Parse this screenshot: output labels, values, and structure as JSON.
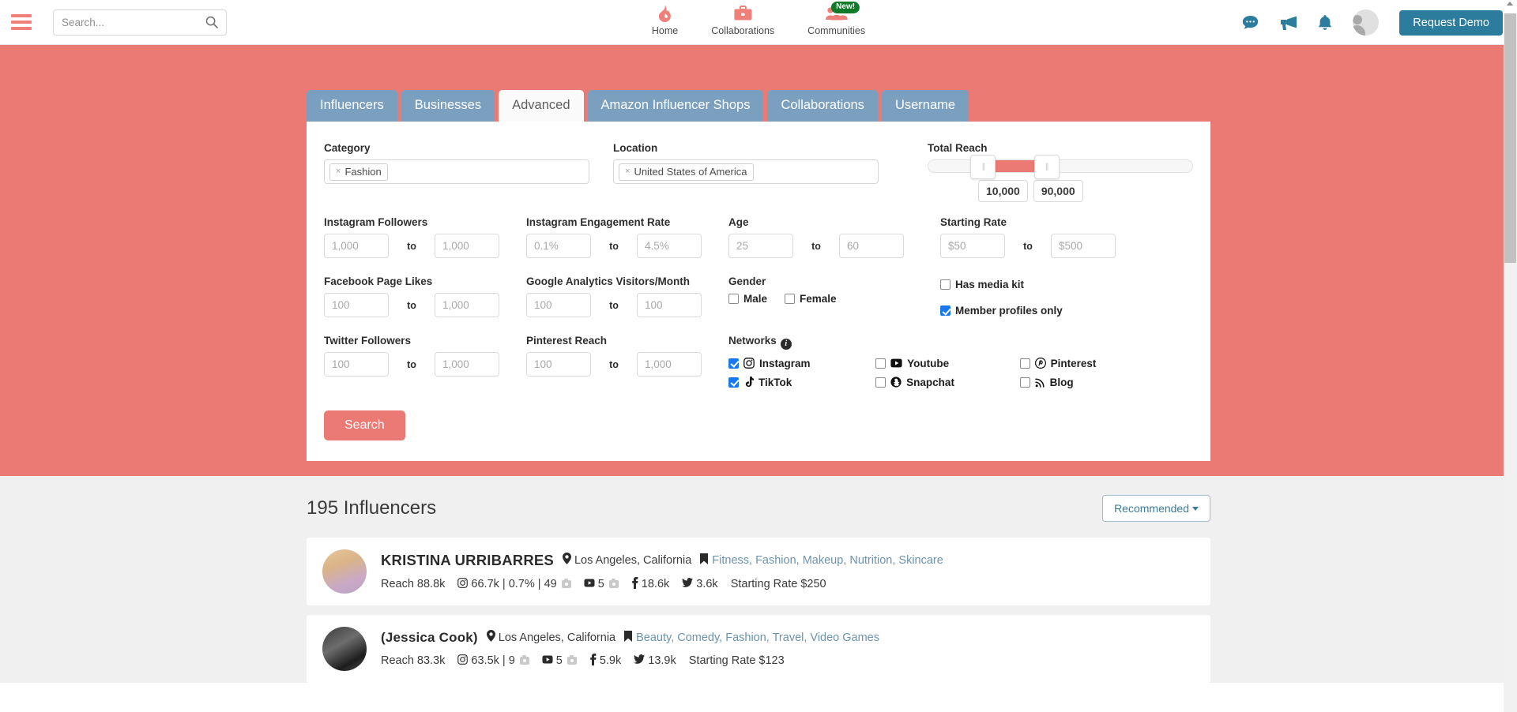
{
  "header": {
    "menu_icon": "hamburger-icon",
    "search_placeholder": "Search...",
    "search_value": "",
    "nav": [
      {
        "label": "Home",
        "icon": "flame-icon",
        "badge": ""
      },
      {
        "label": "Collaborations",
        "icon": "briefcase-icon",
        "badge": ""
      },
      {
        "label": "Communities",
        "icon": "people-icon",
        "badge": "New!"
      }
    ],
    "icons": [
      "chat-icon",
      "megaphone-icon",
      "bell-icon"
    ],
    "avatar": "user-avatar",
    "request_demo": "Request Demo"
  },
  "tabs": [
    {
      "label": "Influencers",
      "active": false
    },
    {
      "label": "Businesses",
      "active": false
    },
    {
      "label": "Advanced",
      "active": true
    },
    {
      "label": "Amazon Influencer Shops",
      "active": false
    },
    {
      "label": "Collaborations",
      "active": false
    },
    {
      "label": "Username",
      "active": false
    }
  ],
  "form": {
    "category": {
      "label": "Category",
      "tokens": [
        "Fashion"
      ]
    },
    "location": {
      "label": "Location",
      "tokens": [
        "United States of America"
      ]
    },
    "total_reach": {
      "label": "Total Reach",
      "min_value": "10,000",
      "max_value": "90,000"
    },
    "ranges": [
      {
        "label": "Instagram Followers",
        "from_placeholder": "1,000",
        "to_placeholder": "1,000",
        "to_label": "to"
      },
      {
        "label": "Instagram Engagement Rate",
        "from_placeholder": "0.1%",
        "to_placeholder": "4.5%",
        "to_label": "to"
      },
      {
        "label": "Age",
        "from_placeholder": "25",
        "to_placeholder": "60",
        "to_label": "to"
      },
      {
        "label": "Starting Rate",
        "from_placeholder": "$50",
        "to_placeholder": "$500",
        "to_label": "to"
      },
      {
        "label": "Facebook Page Likes",
        "from_placeholder": "100",
        "to_placeholder": "1,000",
        "to_label": "to"
      },
      {
        "label": "Google Analytics Visitors/Month",
        "from_placeholder": "100",
        "to_placeholder": "100",
        "to_label": "to"
      },
      {
        "label": "Twitter Followers",
        "from_placeholder": "100",
        "to_placeholder": "1,000",
        "to_label": "to"
      },
      {
        "label": "Pinterest Reach",
        "from_placeholder": "100",
        "to_placeholder": "1,000",
        "to_label": "to"
      }
    ],
    "gender": {
      "label": "Gender",
      "options": [
        {
          "label": "Male",
          "checked": false
        },
        {
          "label": "Female",
          "checked": false
        }
      ]
    },
    "flags": [
      {
        "label": "Has media kit",
        "checked": false
      },
      {
        "label": "Member profiles only",
        "checked": true
      }
    ],
    "networks": {
      "label": "Networks",
      "info_icon": "info-icon",
      "items": [
        {
          "label": "Instagram",
          "icon": "instagram-icon",
          "checked": true
        },
        {
          "label": "Youtube",
          "icon": "youtube-icon",
          "checked": false
        },
        {
          "label": "Pinterest",
          "icon": "pinterest-icon",
          "checked": false
        },
        {
          "label": "TikTok",
          "icon": "tiktok-icon",
          "checked": true
        },
        {
          "label": "Snapchat",
          "icon": "snapchat-icon",
          "checked": false
        },
        {
          "label": "Blog",
          "icon": "rss-icon",
          "checked": false
        }
      ]
    },
    "search_button": "Search"
  },
  "results": {
    "count_title": "195 Influencers",
    "sort_label": "Recommended",
    "cards": [
      {
        "name": "KRISTINA URRIBARRES",
        "location": "Los Angeles, California",
        "categories": "Fitness, Fashion, Makeup, Nutrition, Skincare",
        "reach_label": "Reach",
        "reach": "88.8k",
        "instagram": "66.7k | 0.7% | 49",
        "youtube": "5",
        "facebook": "18.6k",
        "twitter": "3.6k",
        "rate_label": "Starting Rate",
        "rate": "$250"
      },
      {
        "name": "(Jessica Cook)",
        "location": "Los Angeles, California",
        "categories": "Beauty, Comedy, Fashion, Travel, Video Games",
        "reach_label": "Reach",
        "reach": "83.3k",
        "instagram": "63.5k | 9",
        "youtube": "5",
        "facebook": "5.9k",
        "twitter": "13.9k",
        "rate_label": "Starting Rate",
        "rate": "$123"
      }
    ]
  },
  "colors": {
    "salmon": "#ec7a74",
    "tab_blue": "#7ba0bf",
    "teal": "#2c7c9e",
    "checkbox_blue": "#1878f0",
    "badge_green": "#0f7a27",
    "link_blue": "#6b93ad"
  }
}
